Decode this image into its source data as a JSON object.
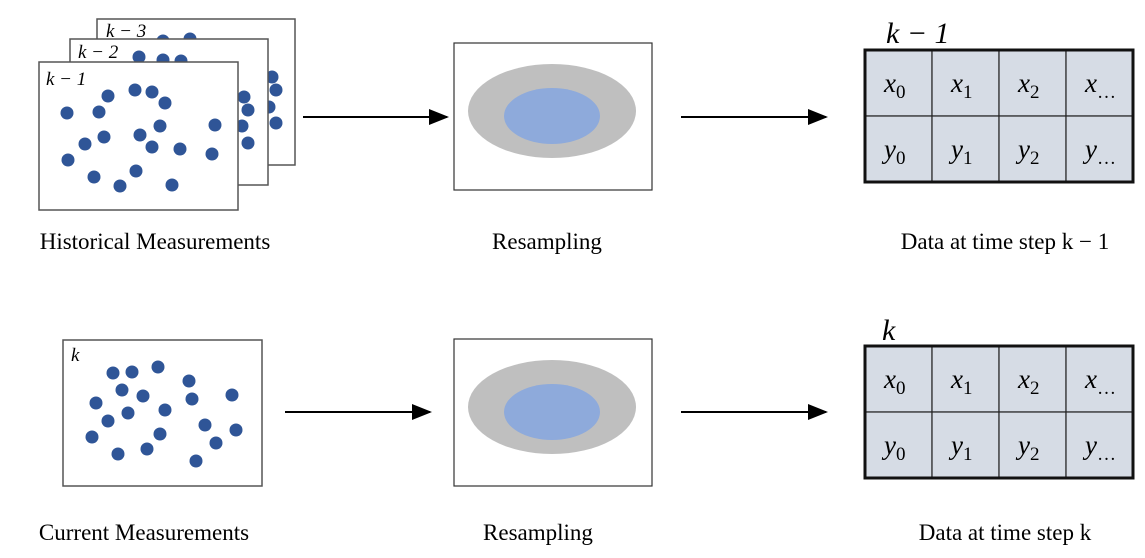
{
  "colors": {
    "dot": "#2f5597",
    "outer_ellipse": "#bfbfbf",
    "inner_ellipse": "#8eaadb",
    "cell_fill": "#d6dce5"
  },
  "top_row": {
    "frames": [
      "k − 3",
      "k − 2",
      "k − 1"
    ],
    "caption_left": "Historical Measurements",
    "caption_mid": "Resampling",
    "caption_right": "Data at time step k − 1",
    "table_label": "k − 1"
  },
  "bottom_row": {
    "frames": [
      "k"
    ],
    "caption_left": "Current Measurements",
    "caption_mid": "Resampling",
    "caption_right": "Data at time step k",
    "table_label": "k"
  },
  "table": {
    "row_x": [
      {
        "base": "x",
        "sub": "0"
      },
      {
        "base": "x",
        "sub": "1"
      },
      {
        "base": "x",
        "sub": "2"
      },
      {
        "base": "x",
        "sub": "…"
      }
    ],
    "row_y": [
      {
        "base": "y",
        "sub": "0"
      },
      {
        "base": "y",
        "sub": "1"
      },
      {
        "base": "y",
        "sub": "2"
      },
      {
        "base": "y",
        "sub": "…"
      }
    ]
  }
}
